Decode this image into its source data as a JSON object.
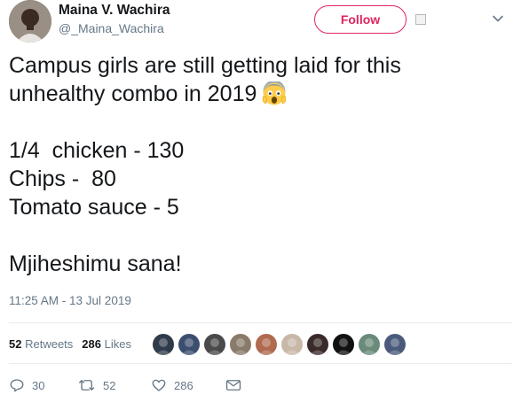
{
  "tweet": {
    "author": {
      "name": "Maina V. Wachira",
      "handle": "@_Maina_Wachira"
    },
    "follow_label": "Follow",
    "text_lines": [
      "Campus girls are still getting laid for this",
      "unhealthy combo in 2019",
      "1/4  chicken - 130",
      "Chips -  80",
      "Tomato sauce - 5",
      "Mjiheshimu sana!"
    ],
    "emoji_icon": "screaming-face-emoji",
    "timestamp": "11:25 AM - 13 Jul 2019",
    "stats": {
      "retweets_count": "52",
      "retweets_label": "Retweets",
      "likes_count": "286",
      "likes_label": "Likes"
    },
    "liker_avatars": [
      {
        "color": "#2f3b4a"
      },
      {
        "color": "#3b4e6e"
      },
      {
        "color": "#4a4a4a"
      },
      {
        "color": "#8a7a6a"
      },
      {
        "color": "#b06a50"
      },
      {
        "color": "#c8b8a8"
      },
      {
        "color": "#3a2a2a"
      },
      {
        "color": "#111111"
      },
      {
        "color": "#6a8a7a"
      },
      {
        "color": "#4a5a7a"
      }
    ],
    "actions": {
      "reply_count": "30",
      "retweet_count": "52",
      "like_count": "286"
    }
  },
  "colors": {
    "accent": "#e0245e",
    "secondary_text": "#657786",
    "divider": "#e6ecf0"
  }
}
